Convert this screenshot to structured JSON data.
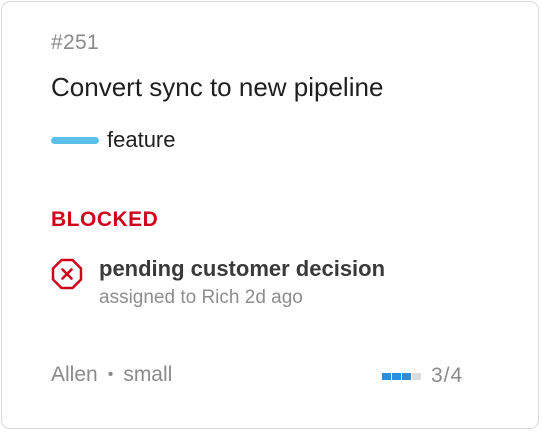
{
  "issue": {
    "number": "#251",
    "title": "Convert sync to new pipeline",
    "label": {
      "text": "feature",
      "color": "#5bc0e8"
    },
    "status": {
      "text": "BLOCKED",
      "color": "#d0021b"
    },
    "blocker": {
      "icon": "x-octagon-icon",
      "title": "pending customer decision",
      "subtitle": "assigned to Rich 2d ago"
    },
    "footer": {
      "assignee": "Allen",
      "separator": "•",
      "size": "small",
      "progress": {
        "done": 3,
        "total": 4,
        "text": "3/4",
        "done_color": "#2a8fe0",
        "remaining_color": "#dcdcdc"
      }
    }
  }
}
